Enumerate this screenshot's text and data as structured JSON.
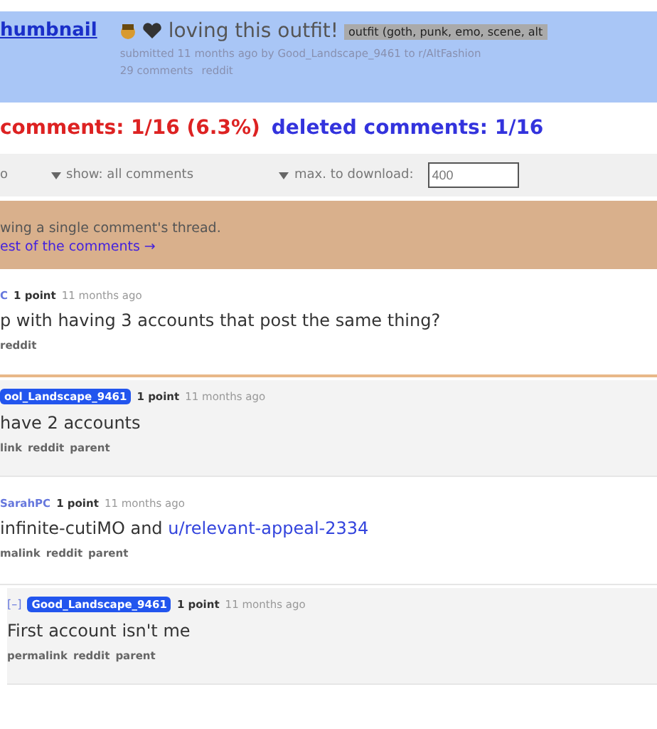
{
  "post": {
    "thumbnail": "humbnail",
    "title": "loving this outfit!",
    "flair": "outfit (goth, punk, emo, scene, alt",
    "submitted": "submitted 11 months ago by Good_Landscape_9461 to r/AltFashion",
    "comments_link": "29 comments",
    "reddit_link": "reddit"
  },
  "stats": {
    "removed": "comments: 1/16 (6.3%)",
    "deleted": "deleted comments: 1/16"
  },
  "toolbar": {
    "sort": "o",
    "show": "show: all comments",
    "max_label": "max. to download:",
    "max_value": "400"
  },
  "notice": {
    "text": "wing a single comment's thread.",
    "link": "est of the comments →"
  },
  "comments": [
    {
      "author": "C",
      "highlighted": false,
      "points": "1 point",
      "time": "11 months ago",
      "body": "p with having 3 accounts that post the same thing?",
      "links": [
        "reddit"
      ],
      "shaded": false,
      "accent": true
    },
    {
      "author": "ool_Landscape_9461",
      "highlighted": true,
      "points": "1 point",
      "time": "11 months ago",
      "body": "have 2 accounts",
      "links": [
        "link",
        "reddit",
        "parent"
      ],
      "shaded": true,
      "accent": false
    },
    {
      "author": "SarahPC",
      "highlighted": false,
      "points": "1 point",
      "time": "11 months ago",
      "body": "infinite-cutiMO and **u/relevant-appeal-2334**",
      "links": [
        "malink",
        "reddit",
        "parent"
      ],
      "shaded": false,
      "accent": false
    },
    {
      "toggle": "[–]",
      "author": "Good_Landscape_9461",
      "highlighted": true,
      "points": "1 point",
      "time": "11 months ago",
      "body": "First account isn't me",
      "links": [
        "permalink",
        "reddit",
        "parent"
      ],
      "shaded": true,
      "accent": false
    }
  ]
}
